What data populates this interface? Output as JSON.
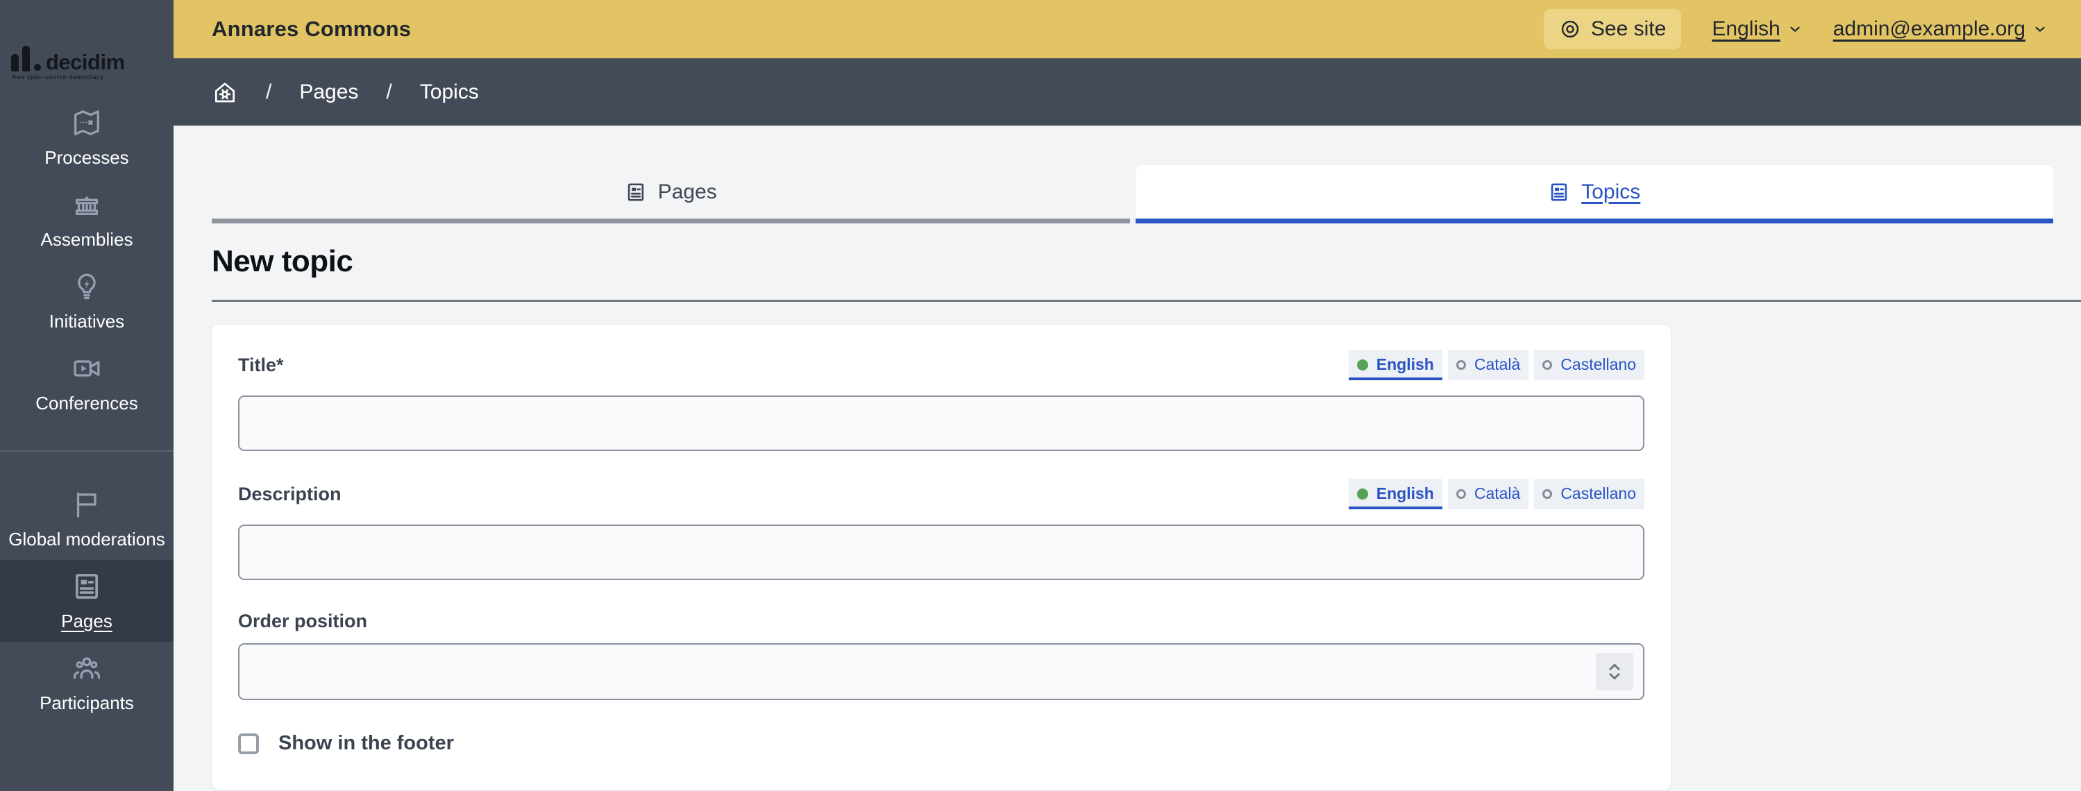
{
  "topbar": {
    "org_name": "Annares Commons",
    "see_site_label": "See site",
    "language_label": "English",
    "account_label": "admin@example.org"
  },
  "logo": {
    "brand": "decidim",
    "tagline": "free open-source democracy"
  },
  "breadcrumb": {
    "separator": "/",
    "items": [
      {
        "label": "Pages"
      },
      {
        "label": "Topics"
      }
    ]
  },
  "sidebar": {
    "items": [
      {
        "label": "Processes",
        "icon": "map-icon",
        "active": false
      },
      {
        "label": "Assemblies",
        "icon": "government-building-icon",
        "active": false
      },
      {
        "label": "Initiatives",
        "icon": "lightbulb-bolt-icon",
        "active": false
      },
      {
        "label": "Conferences",
        "icon": "video-camera-icon",
        "active": false
      },
      {
        "label": "Global moderations",
        "icon": "flag-icon",
        "active": false
      },
      {
        "label": "Pages",
        "icon": "page-icon",
        "active": true
      },
      {
        "label": "Participants",
        "icon": "people-icon",
        "active": false
      }
    ]
  },
  "tabs": [
    {
      "label": "Pages",
      "icon": "page-icon",
      "active": false
    },
    {
      "label": "Topics",
      "icon": "page-icon",
      "active": true
    }
  ],
  "page": {
    "title": "New topic"
  },
  "form": {
    "title": {
      "label": "Title*",
      "value": ""
    },
    "description": {
      "label": "Description",
      "value": ""
    },
    "order": {
      "label": "Order position",
      "value": ""
    },
    "show_in_footer": {
      "label": "Show in the footer",
      "checked": false
    },
    "languages": [
      {
        "label": "English",
        "selected": true
      },
      {
        "label": "Català",
        "selected": false
      },
      {
        "label": "Castellano",
        "selected": false
      }
    ]
  },
  "colors": {
    "topbar_yellow": "#e2c464",
    "sidebar_dark": "#434b58",
    "accent_blue": "#2a54c5",
    "selected_green": "#55a356",
    "page_background": "#f3f4f6"
  }
}
